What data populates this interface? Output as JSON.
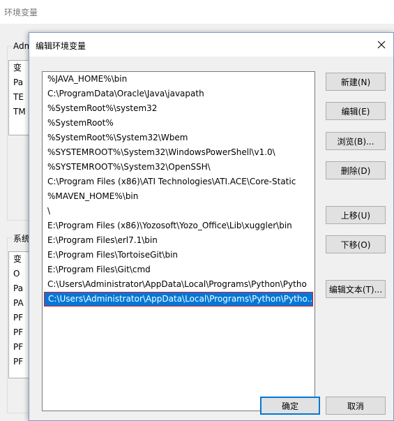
{
  "parent_window": {
    "title": "环境变量",
    "user_group_label": "Adm",
    "user_rows": [
      "变",
      "Pa",
      "TE",
      "TM"
    ],
    "system_group_label": "系统",
    "system_rows": [
      "变",
      "O",
      "Pa",
      "PA",
      "PF",
      "PF",
      "PF",
      "PF"
    ]
  },
  "dialog": {
    "title": "编辑环境变量",
    "close_icon": "close-icon",
    "paths": [
      "%JAVA_HOME%\\bin",
      "C:\\ProgramData\\Oracle\\Java\\javapath",
      "%SystemRoot%\\system32",
      "%SystemRoot%",
      "%SystemRoot%\\System32\\Wbem",
      "%SYSTEMROOT%\\System32\\WindowsPowerShell\\v1.0\\",
      "%SYSTEMROOT%\\System32\\OpenSSH\\",
      "C:\\Program Files (x86)\\ATI Technologies\\ATI.ACE\\Core-Static",
      "%MAVEN_HOME%\\bin",
      "\\",
      "E:\\Program Files (x86)\\Yozosoft\\Yozo_Office\\Lib\\xuggler\\bin",
      "E:\\Program Files\\erl7.1\\bin",
      "E:\\Program Files\\TortoiseGit\\bin",
      "E:\\Program Files\\Git\\cmd",
      "C:\\Users\\Administrator\\AppData\\Local\\Programs\\Python\\Pytho",
      "C:\\Users\\Administrator\\AppData\\Local\\Programs\\Python\\Pytho..."
    ],
    "selected_index": 15,
    "buttons": {
      "new": "新建(N)",
      "edit": "编辑(E)",
      "browse": "浏览(B)...",
      "delete": "删除(D)",
      "move_up": "上移(U)",
      "move_down": "下移(O)",
      "edit_text": "编辑文本(T)...",
      "ok": "确定",
      "cancel": "取消"
    },
    "colors": {
      "selection": "#0078d7",
      "selection_outline": "#e81123"
    }
  }
}
